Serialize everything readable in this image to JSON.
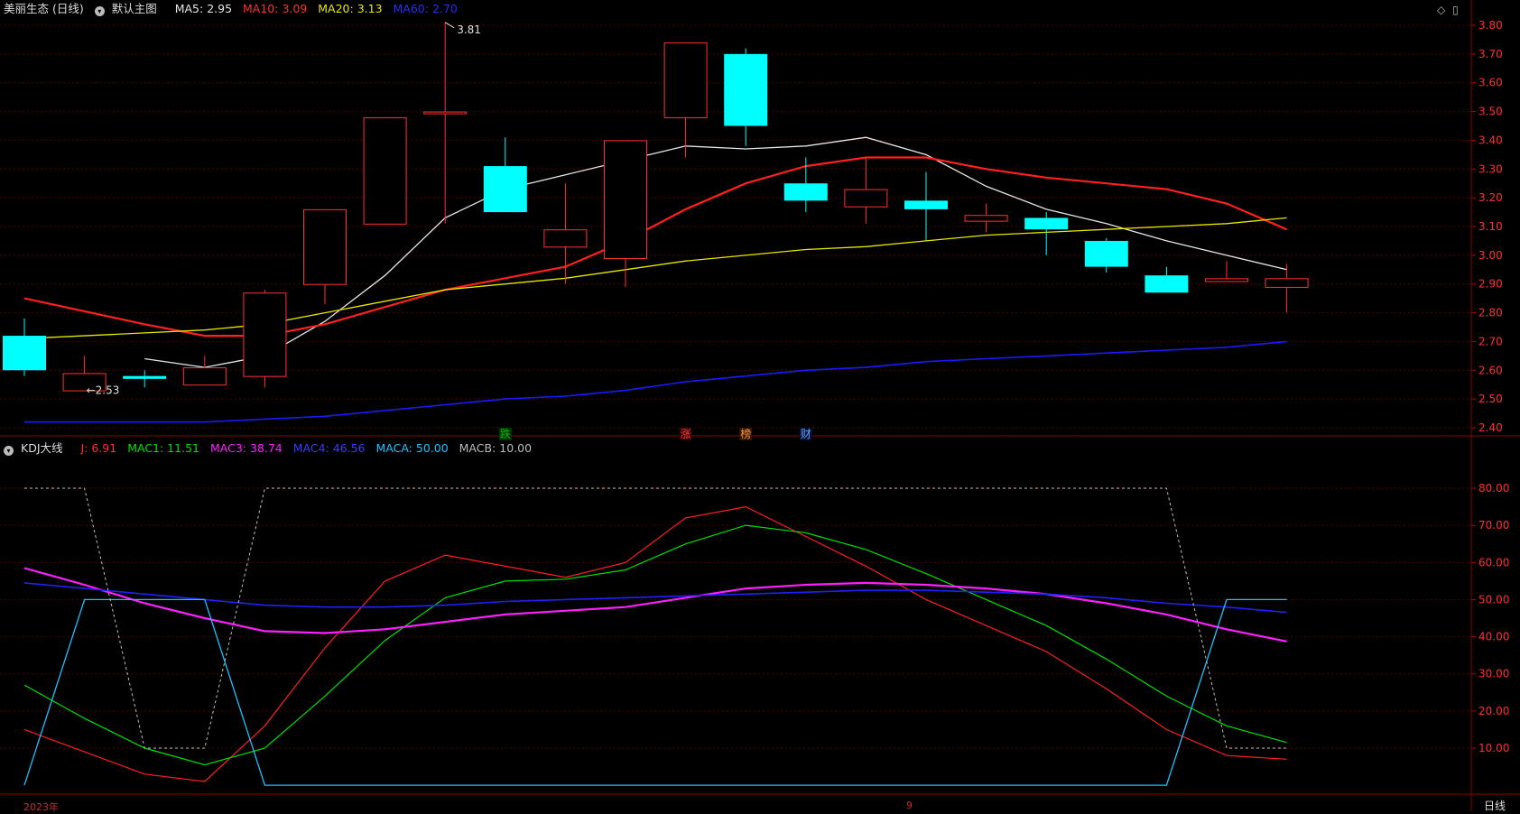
{
  "header": {
    "stock_name": "美丽生态 (日线)",
    "main_chart_label": "默认主图",
    "ma5": "MA5: 2.95",
    "ma10": "MA10: 3.09",
    "ma20": "MA20: 3.13",
    "ma60": "MA60: 2.70"
  },
  "kdj_header": {
    "name": "KDJ大线",
    "j": "J: 6.91",
    "mac1": "MAC1: 11.51",
    "mac3": "MAC3: 38.74",
    "mac4": "MAC4: 46.56",
    "maca": "MACA: 50.00",
    "macb": "MACB: 10.00"
  },
  "footer": {
    "year": "2023年",
    "month": "9",
    "period": "日线"
  },
  "colors": {
    "up": "#ff3232",
    "down": "#00ffff",
    "ma5": "#e6e6e6",
    "ma10": "#ff2020",
    "ma20": "#e6e600",
    "ma60": "#1a1aff",
    "grid": "#5a0000",
    "j": "#ff2020",
    "mac1": "#00e000",
    "mac3": "#ff20ff",
    "mac4": "#2020ff",
    "maca": "#20c0ff",
    "macb": "#c0c0c0"
  },
  "chart_data": [
    {
      "type": "candlestick",
      "yticks": [
        "3.80",
        "3.70",
        "3.60",
        "3.50",
        "3.40",
        "3.30",
        "3.20",
        "3.10",
        "3.00",
        "2.90",
        "2.80",
        "2.70",
        "2.60",
        "2.50",
        "2.40"
      ],
      "ylim": [
        2.38,
        3.83
      ],
      "candles": [
        {
          "o": 2.72,
          "h": 2.78,
          "l": 2.58,
          "c": 2.6
        },
        {
          "o": 2.53,
          "h": 2.65,
          "l": 2.53,
          "c": 2.59
        },
        {
          "o": 2.58,
          "h": 2.6,
          "l": 2.54,
          "c": 2.57
        },
        {
          "o": 2.55,
          "h": 2.65,
          "l": 2.55,
          "c": 2.61
        },
        {
          "o": 2.58,
          "h": 2.88,
          "l": 2.54,
          "c": 2.87
        },
        {
          "o": 2.9,
          "h": 3.16,
          "l": 2.83,
          "c": 3.16
        },
        {
          "o": 3.11,
          "h": 3.48,
          "l": 3.11,
          "c": 3.48
        },
        {
          "o": 3.5,
          "h": 3.81,
          "l": 3.11,
          "c": 3.5
        },
        {
          "o": 3.31,
          "h": 3.41,
          "l": 3.15,
          "c": 3.15
        },
        {
          "o": 3.03,
          "h": 3.25,
          "l": 2.9,
          "c": 3.09
        },
        {
          "o": 2.99,
          "h": 3.4,
          "l": 2.89,
          "c": 3.4
        },
        {
          "o": 3.48,
          "h": 3.74,
          "l": 3.34,
          "c": 3.74
        },
        {
          "o": 3.7,
          "h": 3.72,
          "l": 3.38,
          "c": 3.45
        },
        {
          "o": 3.25,
          "h": 3.34,
          "l": 3.15,
          "c": 3.19
        },
        {
          "o": 3.17,
          "h": 3.34,
          "l": 3.11,
          "c": 3.23
        },
        {
          "o": 3.19,
          "h": 3.29,
          "l": 3.05,
          "c": 3.16
        },
        {
          "o": 3.12,
          "h": 3.18,
          "l": 3.08,
          "c": 3.14
        },
        {
          "o": 3.13,
          "h": 3.15,
          "l": 3.0,
          "c": 3.09
        },
        {
          "o": 3.05,
          "h": 3.06,
          "l": 2.94,
          "c": 2.96
        },
        {
          "o": 2.93,
          "h": 2.96,
          "l": 2.87,
          "c": 2.87
        },
        {
          "o": 2.91,
          "h": 2.98,
          "l": 2.91,
          "c": 2.92
        },
        {
          "o": 2.89,
          "h": 2.97,
          "l": 2.8,
          "c": 2.92
        }
      ],
      "series": [
        {
          "name": "MA5",
          "values": [
            null,
            null,
            2.64,
            2.61,
            2.65,
            2.77,
            2.93,
            3.13,
            3.23,
            3.28,
            3.33,
            3.38,
            3.37,
            3.38,
            3.41,
            3.35,
            3.24,
            3.16,
            3.11,
            3.05,
            3.0,
            2.95
          ]
        },
        {
          "name": "MA10",
          "values": [
            2.85,
            null,
            2.76,
            2.72,
            2.72,
            2.76,
            2.82,
            2.88,
            2.92,
            2.96,
            3.05,
            3.16,
            3.25,
            3.31,
            3.34,
            3.34,
            3.3,
            3.27,
            3.25,
            3.23,
            3.18,
            3.09
          ]
        },
        {
          "name": "MA20",
          "values": [
            2.71,
            null,
            2.73,
            2.74,
            2.76,
            2.8,
            2.84,
            2.88,
            2.9,
            2.92,
            2.95,
            2.98,
            3.0,
            3.02,
            3.03,
            3.05,
            3.07,
            3.08,
            3.09,
            3.1,
            3.11,
            3.13
          ]
        },
        {
          "name": "MA60",
          "values": [
            2.42,
            2.42,
            2.42,
            2.42,
            2.43,
            2.44,
            2.46,
            2.48,
            2.5,
            2.51,
            2.53,
            2.56,
            2.58,
            2.6,
            2.61,
            2.63,
            2.64,
            2.65,
            2.66,
            2.67,
            2.68,
            2.7
          ]
        }
      ],
      "annotations": [
        {
          "index": 7,
          "value": 3.81,
          "text": "3.81"
        },
        {
          "index": 1,
          "value": 2.53,
          "text": "←2.53"
        }
      ],
      "markers": [
        {
          "index": 8,
          "text": "跌",
          "color": "#00c000",
          "bg": "#003000"
        },
        {
          "index": 11,
          "text": "涨",
          "color": "#ff4040",
          "bg": "#300000"
        },
        {
          "index": 12,
          "text": "榜",
          "color": "#ff9040",
          "bg": "#301800"
        },
        {
          "index": 13,
          "text": "财",
          "color": "#6aa0ff",
          "bg": "#001030"
        }
      ]
    },
    {
      "type": "line",
      "yticks": [
        "80.00",
        "70.00",
        "60.00",
        "50.00",
        "40.00",
        "30.00",
        "20.00",
        "10.00"
      ],
      "ylim": [
        0,
        82
      ],
      "series": [
        {
          "name": "J",
          "values": [
            15,
            9,
            3,
            1,
            16,
            37,
            55,
            62,
            59,
            56,
            60,
            72,
            75,
            67,
            59,
            50,
            43,
            36,
            26,
            15,
            8,
            7
          ]
        },
        {
          "name": "MAC1",
          "values": [
            27,
            18,
            10,
            5.5,
            10,
            24,
            39,
            50.5,
            55,
            55.5,
            58,
            65,
            70,
            68,
            63.5,
            57,
            50,
            43,
            34,
            24,
            16,
            11.5
          ]
        },
        {
          "name": "MAC3",
          "values": [
            58.5,
            54,
            49,
            45,
            41.5,
            41,
            42,
            44,
            46,
            47,
            48,
            50.5,
            53,
            54,
            54.5,
            54,
            53,
            51.5,
            49,
            46,
            42,
            38.74
          ]
        },
        {
          "name": "MAC4",
          "values": [
            54.5,
            53,
            51.5,
            50,
            48.5,
            48,
            48,
            48.5,
            49.5,
            50,
            50.5,
            51,
            51.5,
            52,
            52.5,
            52.5,
            52,
            51.5,
            50.5,
            49,
            48,
            46.56
          ]
        },
        {
          "name": "MACA",
          "values": [
            0,
            50,
            50,
            50,
            0,
            0,
            0,
            0,
            0,
            0,
            0,
            0,
            0,
            0,
            0,
            0,
            0,
            0,
            0,
            0,
            50,
            50
          ]
        },
        {
          "name": "MACB",
          "values": [
            80,
            80,
            10,
            10,
            80,
            80,
            80,
            80,
            80,
            80,
            80,
            80,
            80,
            80,
            80,
            80,
            80,
            80,
            80,
            80,
            10,
            10
          ]
        }
      ]
    }
  ]
}
